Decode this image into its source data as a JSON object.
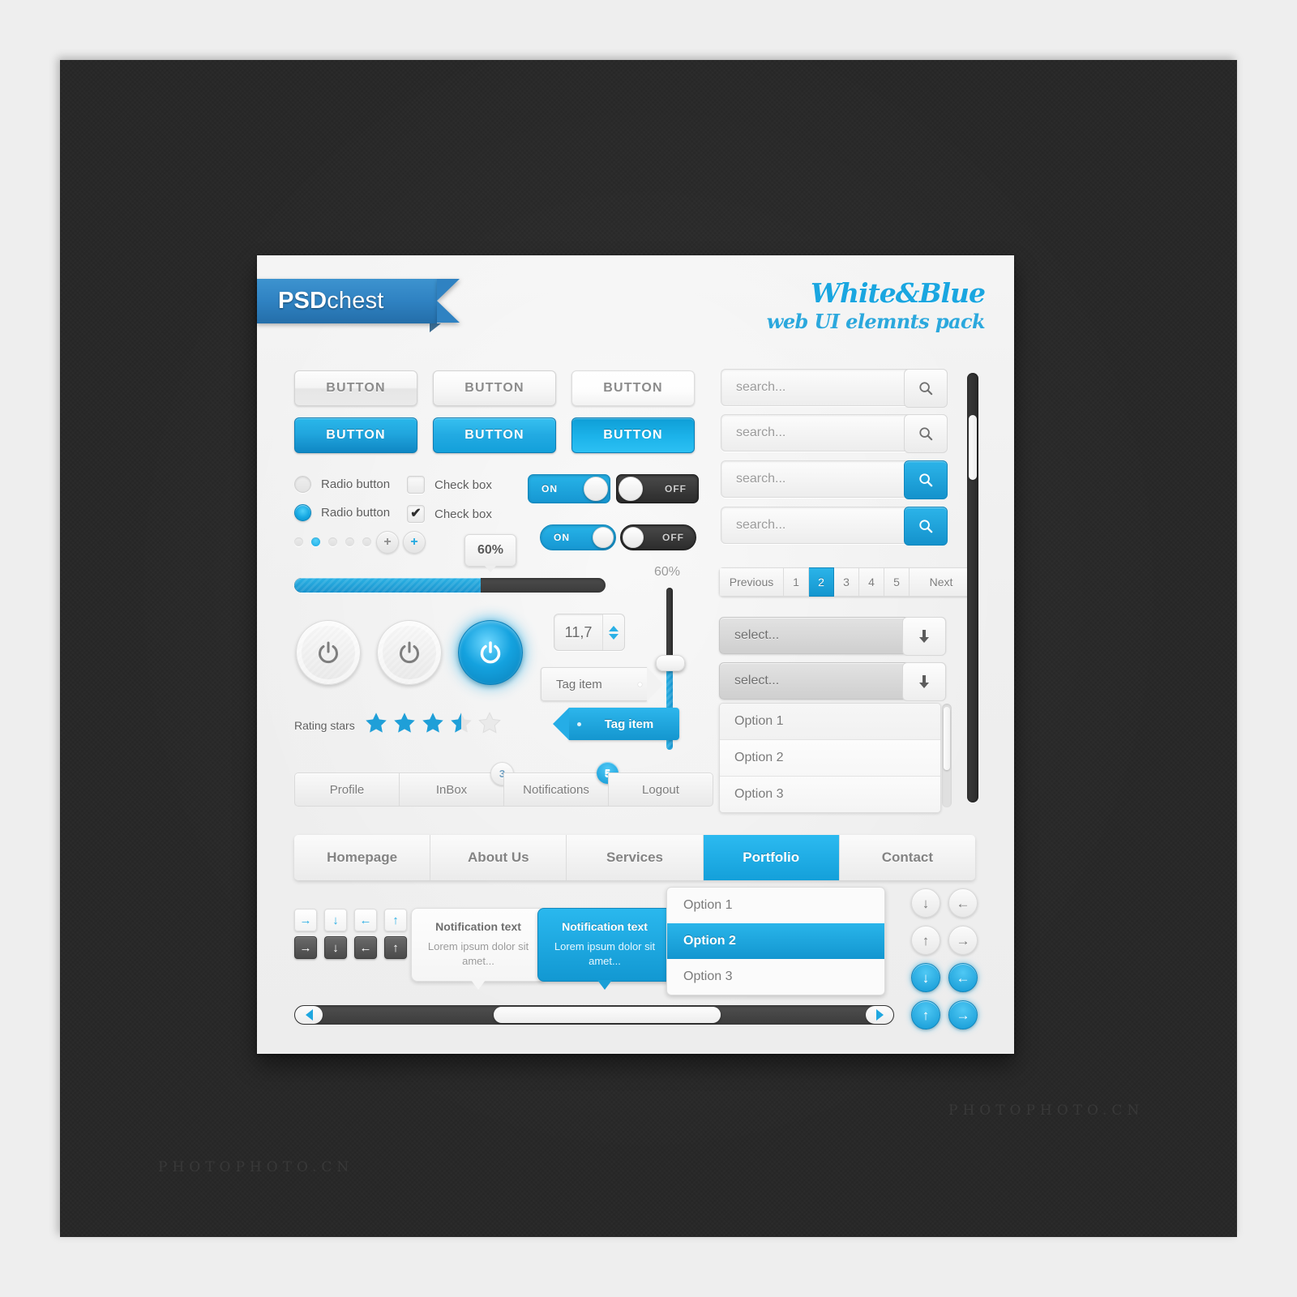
{
  "brand": {
    "logo_bold": "PSD",
    "logo_light": "chest"
  },
  "headline": {
    "line1": "White&Blue",
    "line2": "web UI elemnts pack"
  },
  "buttons": {
    "row_white": [
      "BUTTON",
      "BUTTON",
      "BUTTON"
    ],
    "row_blue": [
      "BUTTON",
      "BUTTON",
      "BUTTON"
    ]
  },
  "controls": {
    "radio_off_label": "Radio button",
    "radio_on_label": "Radio button",
    "checkbox_off_label": "Check box",
    "checkbox_on_label": "Check box",
    "checkbox_mark": "✔",
    "toggle_large_on": "ON",
    "toggle_large_off": "OFF",
    "toggle_small_on": "ON",
    "toggle_small_off": "OFF",
    "plus_label": "+",
    "plus_blue_label": "+",
    "dots_count": 5,
    "dots_active_index": 1
  },
  "progress": {
    "tooltip_value": "60%",
    "percent": 60,
    "slider_label": "60%",
    "slider_percent": 60
  },
  "power": {
    "states": [
      "off",
      "off",
      "on"
    ]
  },
  "rating": {
    "label": "Rating stars",
    "value": 3.5,
    "max": 5
  },
  "spinner": {
    "value": "11,7"
  },
  "tags": {
    "white": "Tag item",
    "blue": "Tag item"
  },
  "account_tabs": [
    {
      "label": "Profile",
      "badge": null
    },
    {
      "label": "InBox",
      "badge": "3",
      "badge_style": "grey"
    },
    {
      "label": "Notifications",
      "badge": "5",
      "badge_style": "blue"
    },
    {
      "label": "Logout",
      "badge": null
    }
  ],
  "search": {
    "placeholder": "search...",
    "fields": [
      {
        "placeholder": "search...",
        "button_style": "white"
      },
      {
        "placeholder": "search...",
        "button_style": "white"
      },
      {
        "placeholder": "search...",
        "button_style": "blue"
      },
      {
        "placeholder": "search...",
        "button_style": "blue"
      }
    ]
  },
  "pagination": {
    "previous": "Previous",
    "next": "Next",
    "pages": [
      "1",
      "2",
      "3",
      "4",
      "5"
    ],
    "active": "2"
  },
  "selects": [
    {
      "placeholder": "select..."
    },
    {
      "placeholder": "select..."
    }
  ],
  "option_list": [
    "Option 1",
    "Option 2",
    "Option 3"
  ],
  "main_nav": {
    "items": [
      "Homepage",
      "About Us",
      "Services",
      "Portfolio",
      "Contact"
    ],
    "active": "Portfolio"
  },
  "dropdown_popup": {
    "items": [
      "Option 1",
      "Option 2",
      "Option 3"
    ],
    "selected": "Option 2"
  },
  "arrow_buttons": {
    "white_row": [
      "→",
      "↓",
      "←",
      "↑"
    ],
    "dark_row": [
      "→",
      "↓",
      "←",
      "↑"
    ]
  },
  "notifications": [
    {
      "title": "Notification text",
      "body": "Lorem ipsum dolor sit amet...",
      "style": "white"
    },
    {
      "title": "Notification text",
      "body": "Lorem ipsum dolor sit amet...",
      "style": "blue"
    }
  ],
  "round_arrows": {
    "white": [
      "↓",
      "←",
      "↑",
      "→"
    ],
    "blue": [
      "↓",
      "←",
      "↑",
      "→"
    ]
  },
  "colors": {
    "accent_blue": "#1aa6e0",
    "accent_blue_dark": "#0f87c4",
    "ribbon_blue": "#2f82c2",
    "panel_bg": "#efefef",
    "backdrop": "#262626",
    "text_grey": "#7c7c7c",
    "track_dark": "#3c3c3c"
  },
  "watermarks": [
    "PHOTOPHOTO.CN",
    "PHOTOPHOTO.CN"
  ]
}
